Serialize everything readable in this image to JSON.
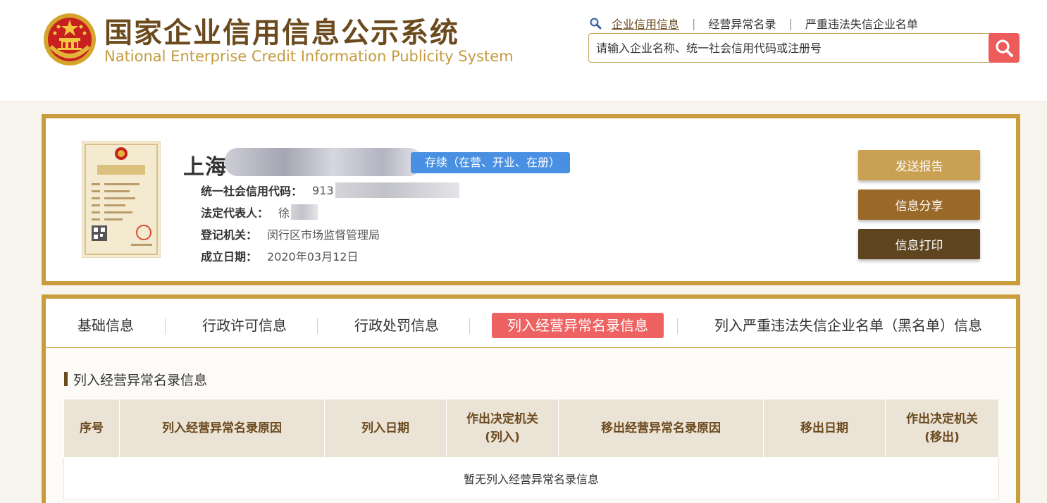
{
  "header": {
    "title_cn": "国家企业信用信息公示系统",
    "title_en": "National Enterprise Credit Information Publicity System",
    "nav": [
      {
        "label": "企业信用信息",
        "active": true
      },
      {
        "label": "经营异常名录",
        "active": false
      },
      {
        "label": "严重违法失信企业名单",
        "active": false
      }
    ],
    "search_placeholder": "请输入企业名称、统一社会信用代码或注册号"
  },
  "company": {
    "name_prefix": "上海",
    "status": "存续（在营、开业、在册）",
    "fields": [
      {
        "label": "统一社会信用代码：",
        "value": "913"
      },
      {
        "label": "法定代表人：",
        "value": "徐"
      },
      {
        "label": "登记机关：",
        "value": "闵行区市场监督管理局"
      },
      {
        "label": "成立日期：",
        "value": "2020年03月12日"
      }
    ],
    "license_title": "营业执照",
    "actions": [
      {
        "label": "发送报告",
        "color": "#caa052"
      },
      {
        "label": "信息分享",
        "color": "#9a6829"
      },
      {
        "label": "信息打印",
        "color": "#5e4520"
      }
    ]
  },
  "tabs": [
    {
      "label": "基础信息",
      "active": false
    },
    {
      "label": "行政许可信息",
      "active": false
    },
    {
      "label": "行政处罚信息",
      "active": false
    },
    {
      "label": "列入经营异常名录信息",
      "active": true
    },
    {
      "label": "列入严重违法失信企业名单（黑名单）信息",
      "active": false
    }
  ],
  "section": {
    "title": "列入经营异常名录信息",
    "columns": [
      "序号",
      "列入经营异常名录原因",
      "列入日期",
      "作出决定机关(列入)",
      "移出经营异常名录原因",
      "移出日期",
      "作出决定机关(移出)"
    ],
    "column_lines": [
      [
        "序号"
      ],
      [
        "列入经营异常名录原因"
      ],
      [
        "列入日期"
      ],
      [
        "作出决定机关",
        "(列入)"
      ],
      [
        "移出经营异常名录原因"
      ],
      [
        "移出日期"
      ],
      [
        "作出决定机关",
        "(移出)"
      ]
    ],
    "empty_text": "暂无列入经营异常名录信息"
  },
  "colors": {
    "brand_brown": "#6b4a1e",
    "gold_border": "#c99c3d",
    "accent_red": "#ee6262",
    "status_blue": "#4a90e2"
  }
}
